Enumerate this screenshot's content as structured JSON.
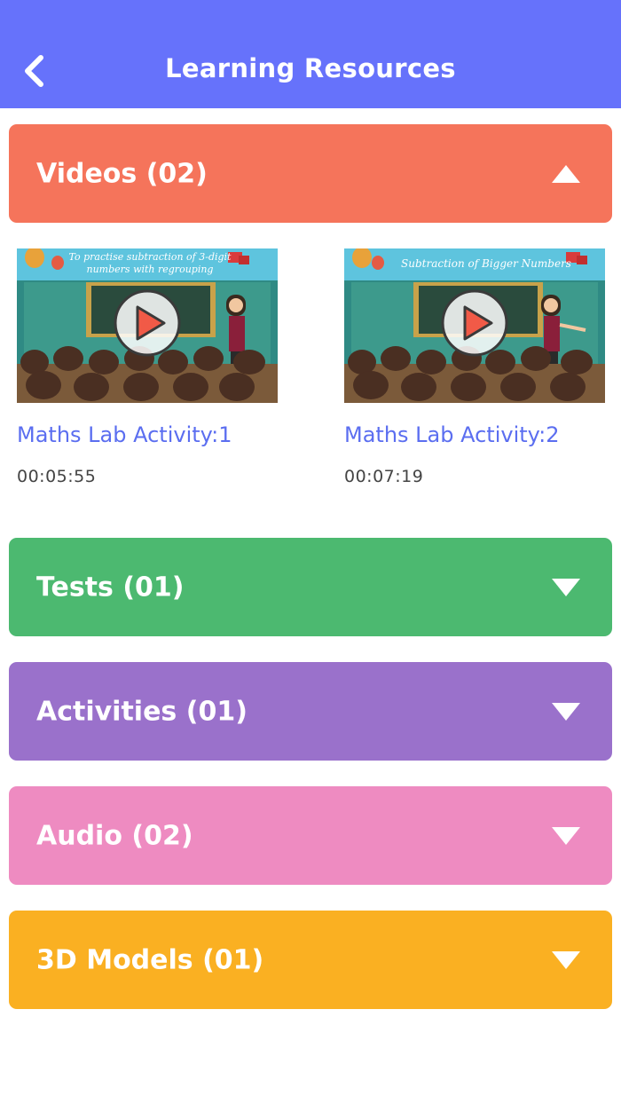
{
  "header": {
    "title": "Learning Resources",
    "back_icon": "chevron-left-icon",
    "color": "#6672fb"
  },
  "sections": [
    {
      "label": "Videos (02)",
      "expanded": true,
      "color": "#f5745b"
    },
    {
      "label": "Tests (01)",
      "expanded": false,
      "color": "#4cb970"
    },
    {
      "label": "Activities (01)",
      "expanded": false,
      "color": "#9a71cb"
    },
    {
      "label": "Audio (02)",
      "expanded": false,
      "color": "#ee8bc1"
    },
    {
      "label": "3D Models (01)",
      "expanded": false,
      "color": "#fab022"
    }
  ],
  "videos": [
    {
      "thumb_caption_line1": "To practise subtraction of 3-digit",
      "thumb_caption_line2": "numbers with regrouping",
      "title": "Maths Lab Activity:1",
      "duration": "00:05:55"
    },
    {
      "thumb_caption_line1": "Subtraction of Bigger Numbers",
      "thumb_caption_line2": "",
      "title": "Maths Lab Activity:2",
      "duration": "00:07:19"
    }
  ],
  "icons": {
    "play": "play-icon",
    "expand": "triangle-down-icon",
    "collapse": "triangle-up-icon"
  }
}
